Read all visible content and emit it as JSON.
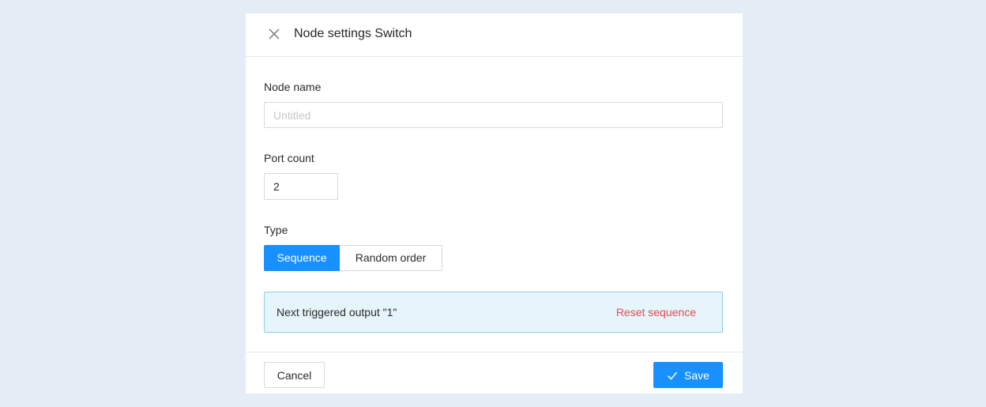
{
  "dialog": {
    "title": "Node settings Switch",
    "close_icon": "close-icon"
  },
  "form": {
    "node_name": {
      "label": "Node name",
      "value": "",
      "placeholder": "Untitled"
    },
    "port_count": {
      "label": "Port count",
      "value": "2"
    },
    "type": {
      "label": "Type",
      "options": [
        "Sequence",
        "Random order"
      ],
      "selected": "Sequence"
    }
  },
  "info": {
    "text": "Next triggered output \"1\"",
    "link": "Reset sequence"
  },
  "footer": {
    "cancel_label": "Cancel",
    "save_label": "Save",
    "save_icon": "check-icon"
  },
  "colors": {
    "page_background": "#e4ecf6",
    "primary": "#1890ff",
    "info_background": "#e6f4fb",
    "info_border": "#91cfe9",
    "danger_link": "#e8484f"
  }
}
